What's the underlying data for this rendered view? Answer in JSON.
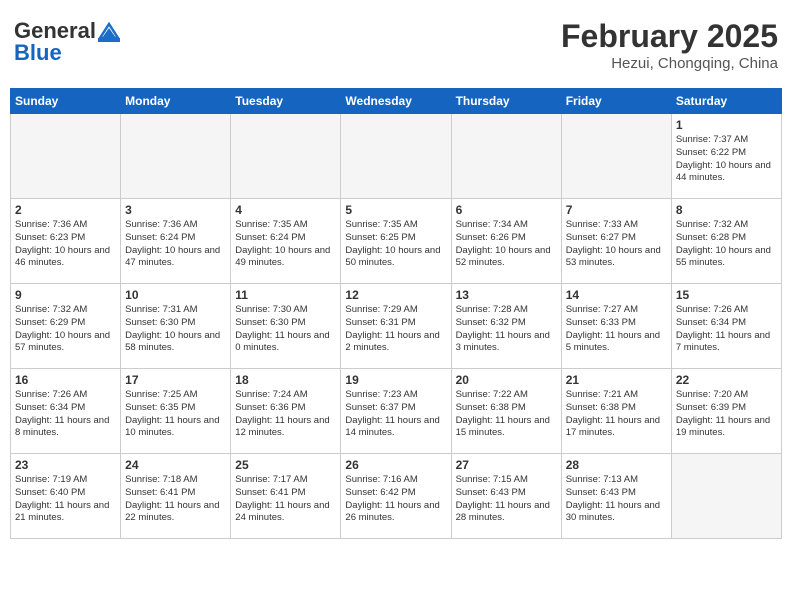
{
  "header": {
    "logo_general": "General",
    "logo_blue": "Blue",
    "month_year": "February 2025",
    "location": "Hezui, Chongqing, China"
  },
  "weekdays": [
    "Sunday",
    "Monday",
    "Tuesday",
    "Wednesday",
    "Thursday",
    "Friday",
    "Saturday"
  ],
  "weeks": [
    [
      {
        "day": "",
        "info": ""
      },
      {
        "day": "",
        "info": ""
      },
      {
        "day": "",
        "info": ""
      },
      {
        "day": "",
        "info": ""
      },
      {
        "day": "",
        "info": ""
      },
      {
        "day": "",
        "info": ""
      },
      {
        "day": "1",
        "info": "Sunrise: 7:37 AM\nSunset: 6:22 PM\nDaylight: 10 hours and 44 minutes."
      }
    ],
    [
      {
        "day": "2",
        "info": "Sunrise: 7:36 AM\nSunset: 6:23 PM\nDaylight: 10 hours and 46 minutes."
      },
      {
        "day": "3",
        "info": "Sunrise: 7:36 AM\nSunset: 6:24 PM\nDaylight: 10 hours and 47 minutes."
      },
      {
        "day": "4",
        "info": "Sunrise: 7:35 AM\nSunset: 6:24 PM\nDaylight: 10 hours and 49 minutes."
      },
      {
        "day": "5",
        "info": "Sunrise: 7:35 AM\nSunset: 6:25 PM\nDaylight: 10 hours and 50 minutes."
      },
      {
        "day": "6",
        "info": "Sunrise: 7:34 AM\nSunset: 6:26 PM\nDaylight: 10 hours and 52 minutes."
      },
      {
        "day": "7",
        "info": "Sunrise: 7:33 AM\nSunset: 6:27 PM\nDaylight: 10 hours and 53 minutes."
      },
      {
        "day": "8",
        "info": "Sunrise: 7:32 AM\nSunset: 6:28 PM\nDaylight: 10 hours and 55 minutes."
      }
    ],
    [
      {
        "day": "9",
        "info": "Sunrise: 7:32 AM\nSunset: 6:29 PM\nDaylight: 10 hours and 57 minutes."
      },
      {
        "day": "10",
        "info": "Sunrise: 7:31 AM\nSunset: 6:30 PM\nDaylight: 10 hours and 58 minutes."
      },
      {
        "day": "11",
        "info": "Sunrise: 7:30 AM\nSunset: 6:30 PM\nDaylight: 11 hours and 0 minutes."
      },
      {
        "day": "12",
        "info": "Sunrise: 7:29 AM\nSunset: 6:31 PM\nDaylight: 11 hours and 2 minutes."
      },
      {
        "day": "13",
        "info": "Sunrise: 7:28 AM\nSunset: 6:32 PM\nDaylight: 11 hours and 3 minutes."
      },
      {
        "day": "14",
        "info": "Sunrise: 7:27 AM\nSunset: 6:33 PM\nDaylight: 11 hours and 5 minutes."
      },
      {
        "day": "15",
        "info": "Sunrise: 7:26 AM\nSunset: 6:34 PM\nDaylight: 11 hours and 7 minutes."
      }
    ],
    [
      {
        "day": "16",
        "info": "Sunrise: 7:26 AM\nSunset: 6:34 PM\nDaylight: 11 hours and 8 minutes."
      },
      {
        "day": "17",
        "info": "Sunrise: 7:25 AM\nSunset: 6:35 PM\nDaylight: 11 hours and 10 minutes."
      },
      {
        "day": "18",
        "info": "Sunrise: 7:24 AM\nSunset: 6:36 PM\nDaylight: 11 hours and 12 minutes."
      },
      {
        "day": "19",
        "info": "Sunrise: 7:23 AM\nSunset: 6:37 PM\nDaylight: 11 hours and 14 minutes."
      },
      {
        "day": "20",
        "info": "Sunrise: 7:22 AM\nSunset: 6:38 PM\nDaylight: 11 hours and 15 minutes."
      },
      {
        "day": "21",
        "info": "Sunrise: 7:21 AM\nSunset: 6:38 PM\nDaylight: 11 hours and 17 minutes."
      },
      {
        "day": "22",
        "info": "Sunrise: 7:20 AM\nSunset: 6:39 PM\nDaylight: 11 hours and 19 minutes."
      }
    ],
    [
      {
        "day": "23",
        "info": "Sunrise: 7:19 AM\nSunset: 6:40 PM\nDaylight: 11 hours and 21 minutes."
      },
      {
        "day": "24",
        "info": "Sunrise: 7:18 AM\nSunset: 6:41 PM\nDaylight: 11 hours and 22 minutes."
      },
      {
        "day": "25",
        "info": "Sunrise: 7:17 AM\nSunset: 6:41 PM\nDaylight: 11 hours and 24 minutes."
      },
      {
        "day": "26",
        "info": "Sunrise: 7:16 AM\nSunset: 6:42 PM\nDaylight: 11 hours and 26 minutes."
      },
      {
        "day": "27",
        "info": "Sunrise: 7:15 AM\nSunset: 6:43 PM\nDaylight: 11 hours and 28 minutes."
      },
      {
        "day": "28",
        "info": "Sunrise: 7:13 AM\nSunset: 6:43 PM\nDaylight: 11 hours and 30 minutes."
      },
      {
        "day": "",
        "info": ""
      }
    ]
  ]
}
